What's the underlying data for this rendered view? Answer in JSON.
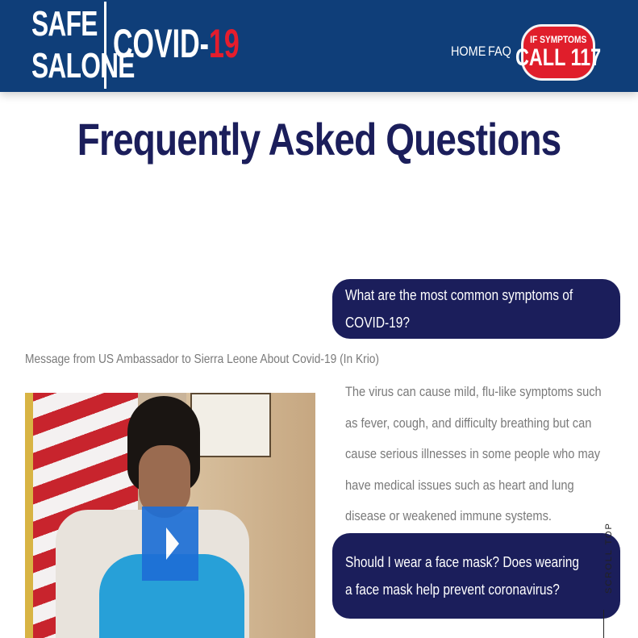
{
  "logo": {
    "line1": "SAFE",
    "line2": "SALONE",
    "covid_prefix": "COVID-",
    "covid_suffix": "19"
  },
  "nav": {
    "home": "HOME",
    "faq": "FAQ"
  },
  "call_badge": {
    "small": "IF SYMPTOMS",
    "big": "CALL 117"
  },
  "page": {
    "title": "Frequently Asked Questions"
  },
  "video": {
    "caption": "Message from US Ambassador to Sierra Leone About Covid-19 (In Krio)"
  },
  "faq": [
    {
      "question": "What are the most common symptoms of COVID-19?",
      "answer": "The virus can cause mild, flu-like symptoms such as fever, cough, and difficulty breathing but can cause serious illnesses in some people who may have medical issues such as heart and lung disease or weakened immune systems."
    },
    {
      "question": "Should I wear a face mask? Does wearing a face mask help prevent coronavirus?"
    }
  ],
  "scroll_top": {
    "label": "SCROLL TOP"
  },
  "colors": {
    "header": "#0f3e79",
    "navy": "#1b1e5b",
    "red": "#e01e2b",
    "muted_text": "#7a7a7a"
  },
  "icons": {
    "play": "play-icon"
  }
}
